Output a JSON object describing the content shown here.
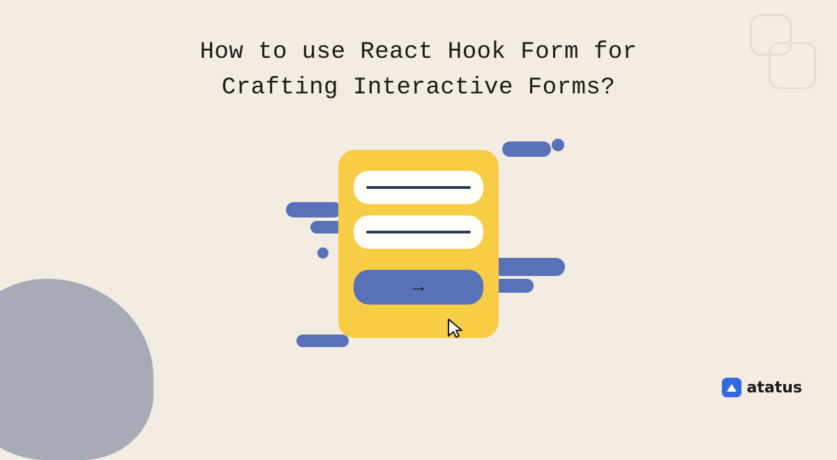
{
  "title": {
    "line1": "How to use React Hook Form for",
    "line2": "Crafting Interactive Forms?"
  },
  "brand": {
    "name": "atatus"
  },
  "colors": {
    "background": "#f2ece2",
    "accent_blue": "#5871b8",
    "card_yellow": "#f8cd46",
    "gray_blob": "#a7abb5",
    "brand_blue": "#3468e0"
  }
}
